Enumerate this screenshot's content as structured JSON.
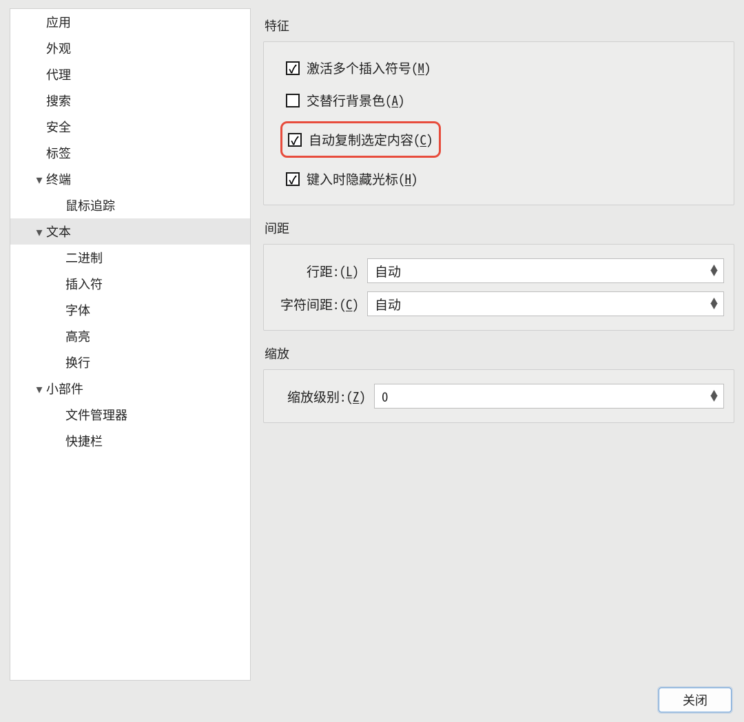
{
  "sidebar": {
    "items": [
      {
        "label": "应用",
        "level": 1,
        "expander": "",
        "selected": false
      },
      {
        "label": "外观",
        "level": 1,
        "expander": "",
        "selected": false
      },
      {
        "label": "代理",
        "level": 1,
        "expander": "",
        "selected": false
      },
      {
        "label": "搜索",
        "level": 1,
        "expander": "",
        "selected": false
      },
      {
        "label": "安全",
        "level": 1,
        "expander": "",
        "selected": false
      },
      {
        "label": "标签",
        "level": 1,
        "expander": "",
        "selected": false
      },
      {
        "label": "终端",
        "level": 1,
        "expander": "▾",
        "selected": false
      },
      {
        "label": "鼠标追踪",
        "level": 2,
        "expander": "",
        "selected": false
      },
      {
        "label": "文本",
        "level": 1,
        "expander": "▾",
        "selected": true
      },
      {
        "label": "二进制",
        "level": 2,
        "expander": "",
        "selected": false
      },
      {
        "label": "插入符",
        "level": 2,
        "expander": "",
        "selected": false
      },
      {
        "label": "字体",
        "level": 2,
        "expander": "",
        "selected": false
      },
      {
        "label": "高亮",
        "level": 2,
        "expander": "",
        "selected": false
      },
      {
        "label": "换行",
        "level": 2,
        "expander": "",
        "selected": false
      },
      {
        "label": "小部件",
        "level": 1,
        "expander": "▾",
        "selected": false
      },
      {
        "label": "文件管理器",
        "level": 2,
        "expander": "",
        "selected": false
      },
      {
        "label": "快捷栏",
        "level": 2,
        "expander": "",
        "selected": false
      }
    ]
  },
  "sections": {
    "features_title": "特征",
    "spacing_title": "间距",
    "zoom_title": "缩放"
  },
  "features": {
    "multi_caret": {
      "pre": "激活多个插入符号(",
      "key": "M",
      "post": ")",
      "checked": true
    },
    "alt_rows": {
      "pre": "交替行背景色(",
      "key": "A",
      "post": ")",
      "checked": false
    },
    "auto_copy": {
      "pre": "自动复制选定内容(",
      "key": "C",
      "post": ")",
      "checked": true,
      "highlighted": true
    },
    "hide_cursor": {
      "pre": "键入时隐藏光标(",
      "key": "H",
      "post": ")",
      "checked": true
    }
  },
  "spacing": {
    "line": {
      "pre": "行距:(",
      "key": "L",
      "post": ")",
      "value": "自动"
    },
    "char": {
      "pre": "字符间距:(",
      "key": "C",
      "post": ")",
      "value": "自动"
    }
  },
  "zoom": {
    "level": {
      "pre": "缩放级别:(",
      "key": "Z",
      "post": ")",
      "value": "0"
    }
  },
  "footer": {
    "close_label": "关闭"
  }
}
